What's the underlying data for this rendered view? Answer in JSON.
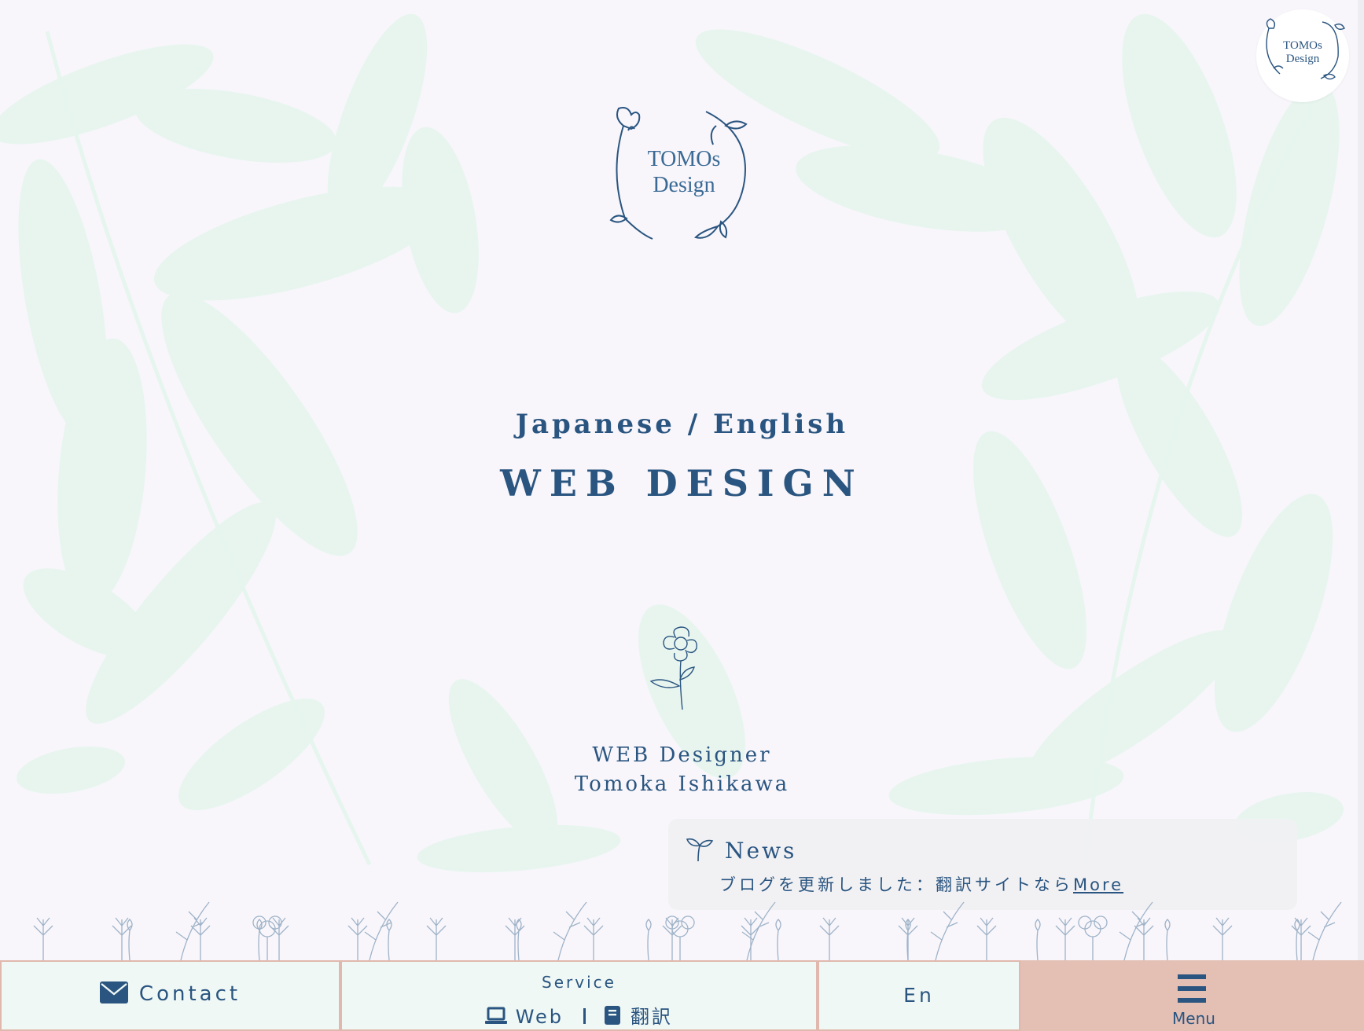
{
  "brand": {
    "logo_line1": "TOMOs",
    "logo_line2": "Design"
  },
  "hero": {
    "subtitle": "Japanese / English",
    "title": "WEB DESIGN",
    "role": "WEB Designer",
    "name": "Tomoka Ishikawa"
  },
  "news": {
    "title": "News",
    "text": "ブログを更新しました：翻訳サイトなら",
    "more": "More"
  },
  "bottom_nav": {
    "contact": "Contact",
    "service_label": "Service",
    "service_web": "Web",
    "service_translation": "翻訳",
    "language": "En",
    "menu": "Menu"
  },
  "icons": [
    "envelope-icon",
    "laptop-icon",
    "book-icon",
    "hamburger-icon",
    "sprout-icon",
    "flower-icon"
  ],
  "colors": {
    "background": "#f8f6fb",
    "leaf": "#e8f6ef",
    "text": "#2a5580",
    "nav_bg": "#f0f8f5",
    "nav_border": "#e0b8ad",
    "menu_bg": "#e3bfb4"
  }
}
